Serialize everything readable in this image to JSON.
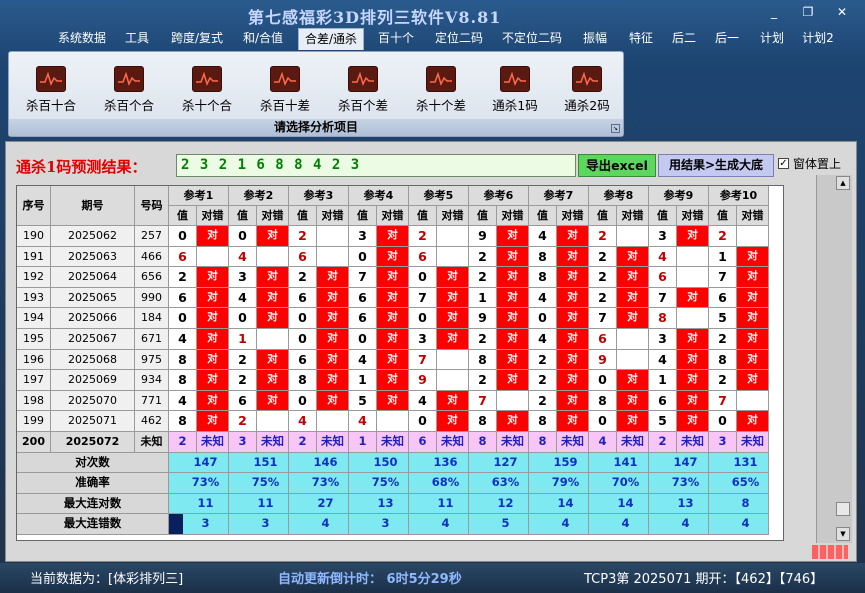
{
  "app": {
    "title": "第七感福彩3D排列三软件V8.81",
    "window_buttons": [
      "_",
      "❐",
      "✕"
    ]
  },
  "menu": [
    {
      "label": "系统数据"
    },
    {
      "label": "工具"
    },
    {
      "label": "跨度/复式"
    },
    {
      "label": "和/合值"
    },
    {
      "label": "合差/通杀",
      "active": true
    },
    {
      "label": "百十个"
    },
    {
      "label": "定位二码"
    },
    {
      "label": "不定位二码"
    },
    {
      "label": "振幅"
    },
    {
      "label": "特征"
    },
    {
      "label": "后二"
    },
    {
      "label": "后一"
    },
    {
      "label": "计划"
    },
    {
      "label": "计划2"
    }
  ],
  "ribbon": {
    "items": [
      {
        "label": "杀百十合",
        "icon": "chart-icon"
      },
      {
        "label": "杀百个合",
        "icon": "chart-icon"
      },
      {
        "label": "杀十个合",
        "icon": "chart-icon"
      },
      {
        "label": "杀百十差",
        "icon": "chart-icon"
      },
      {
        "label": "杀百个差",
        "icon": "chart-icon"
      },
      {
        "label": "杀十个差",
        "icon": "chart-icon"
      },
      {
        "label": "通杀1码",
        "icon": "chart-icon"
      },
      {
        "label": "通杀2码",
        "icon": "chart-icon"
      }
    ],
    "caption": "请选择分析项目"
  },
  "prediction": {
    "label": "通杀1码预测结果：",
    "value": "2 3 2 1 6 8 8 4 2 3",
    "export_button": "导出excel",
    "generate_button": "用结果>生成大底",
    "topmost_checked": true,
    "topmost_label": "窗体置上"
  },
  "table": {
    "col_headers": {
      "seq": "序号",
      "period": "期号",
      "number": "号码"
    },
    "groups": [
      "参考1",
      "参考2",
      "参考3",
      "参考4",
      "参考5",
      "参考6",
      "参考7",
      "参考8",
      "参考9",
      "参考10"
    ],
    "sub_headers": {
      "value": "值",
      "result": "对错"
    },
    "hit_text": "对",
    "rows": [
      {
        "seq": "190",
        "period": "2025062",
        "number": "257",
        "refs": [
          [
            "0",
            1,
            0
          ],
          [
            "0",
            1,
            0
          ],
          [
            "2",
            0,
            1
          ],
          [
            "3",
            1,
            0
          ],
          [
            "2",
            0,
            1
          ],
          [
            "9",
            1,
            0
          ],
          [
            "4",
            1,
            0
          ],
          [
            "2",
            0,
            1
          ],
          [
            "3",
            1,
            0
          ],
          [
            "2",
            0,
            1
          ]
        ]
      },
      {
        "seq": "191",
        "period": "2025063",
        "number": "466",
        "refs": [
          [
            "6",
            0,
            1
          ],
          [
            "4",
            0,
            1
          ],
          [
            "6",
            0,
            1
          ],
          [
            "0",
            1,
            0
          ],
          [
            "6",
            0,
            1
          ],
          [
            "2",
            1,
            0
          ],
          [
            "8",
            1,
            0
          ],
          [
            "2",
            1,
            0
          ],
          [
            "4",
            0,
            1
          ],
          [
            "1",
            1,
            0
          ]
        ]
      },
      {
        "seq": "192",
        "period": "2025064",
        "number": "656",
        "refs": [
          [
            "2",
            1,
            0
          ],
          [
            "3",
            1,
            0
          ],
          [
            "2",
            1,
            0
          ],
          [
            "7",
            1,
            0
          ],
          [
            "0",
            1,
            0
          ],
          [
            "2",
            1,
            0
          ],
          [
            "8",
            1,
            0
          ],
          [
            "2",
            1,
            0
          ],
          [
            "6",
            0,
            1
          ],
          [
            "7",
            1,
            0
          ]
        ]
      },
      {
        "seq": "193",
        "period": "2025065",
        "number": "990",
        "refs": [
          [
            "6",
            1,
            0
          ],
          [
            "4",
            1,
            0
          ],
          [
            "6",
            1,
            0
          ],
          [
            "6",
            1,
            0
          ],
          [
            "7",
            1,
            0
          ],
          [
            "1",
            1,
            0
          ],
          [
            "4",
            1,
            0
          ],
          [
            "2",
            1,
            0
          ],
          [
            "7",
            1,
            0
          ],
          [
            "6",
            1,
            0
          ]
        ]
      },
      {
        "seq": "194",
        "period": "2025066",
        "number": "184",
        "refs": [
          [
            "0",
            1,
            0
          ],
          [
            "0",
            1,
            0
          ],
          [
            "0",
            1,
            0
          ],
          [
            "6",
            1,
            0
          ],
          [
            "0",
            1,
            0
          ],
          [
            "9",
            1,
            0
          ],
          [
            "0",
            1,
            0
          ],
          [
            "7",
            1,
            0
          ],
          [
            "8",
            0,
            1
          ],
          [
            "5",
            1,
            0
          ]
        ]
      },
      {
        "seq": "195",
        "period": "2025067",
        "number": "671",
        "refs": [
          [
            "4",
            1,
            0
          ],
          [
            "1",
            0,
            1
          ],
          [
            "0",
            1,
            0
          ],
          [
            "0",
            1,
            0
          ],
          [
            "3",
            1,
            0
          ],
          [
            "2",
            1,
            0
          ],
          [
            "4",
            1,
            0
          ],
          [
            "6",
            0,
            1
          ],
          [
            "3",
            1,
            0
          ],
          [
            "2",
            1,
            0
          ]
        ]
      },
      {
        "seq": "196",
        "period": "2025068",
        "number": "975",
        "refs": [
          [
            "8",
            1,
            0
          ],
          [
            "2",
            1,
            0
          ],
          [
            "6",
            1,
            0
          ],
          [
            "4",
            1,
            0
          ],
          [
            "7",
            0,
            1
          ],
          [
            "8",
            1,
            0
          ],
          [
            "2",
            1,
            0
          ],
          [
            "9",
            0,
            1
          ],
          [
            "4",
            1,
            0
          ],
          [
            "8",
            1,
            0
          ]
        ]
      },
      {
        "seq": "197",
        "period": "2025069",
        "number": "934",
        "refs": [
          [
            "8",
            1,
            0
          ],
          [
            "2",
            1,
            0
          ],
          [
            "8",
            1,
            0
          ],
          [
            "1",
            1,
            0
          ],
          [
            "9",
            0,
            1
          ],
          [
            "2",
            1,
            0
          ],
          [
            "2",
            1,
            0
          ],
          [
            "0",
            1,
            0
          ],
          [
            "1",
            1,
            0
          ],
          [
            "2",
            1,
            0
          ]
        ]
      },
      {
        "seq": "198",
        "period": "2025070",
        "number": "771",
        "refs": [
          [
            "4",
            1,
            0
          ],
          [
            "6",
            1,
            0
          ],
          [
            "0",
            1,
            0
          ],
          [
            "5",
            1,
            0
          ],
          [
            "4",
            1,
            0
          ],
          [
            "7",
            0,
            1
          ],
          [
            "2",
            1,
            0
          ],
          [
            "8",
            1,
            0
          ],
          [
            "6",
            1,
            0
          ],
          [
            "7",
            0,
            1
          ]
        ]
      },
      {
        "seq": "199",
        "period": "2025071",
        "number": "462",
        "refs": [
          [
            "8",
            1,
            0
          ],
          [
            "2",
            0,
            1
          ],
          [
            "4",
            0,
            1
          ],
          [
            "4",
            0,
            1
          ],
          [
            "0",
            1,
            0
          ],
          [
            "8",
            1,
            0
          ],
          [
            "8",
            1,
            0
          ],
          [
            "0",
            1,
            0
          ],
          [
            "5",
            1,
            0
          ],
          [
            "0",
            1,
            0
          ]
        ]
      }
    ],
    "prediction_row": {
      "seq": "200",
      "period": "2025072",
      "number": "未知",
      "values": [
        "2",
        "3",
        "2",
        "1",
        "6",
        "8",
        "8",
        "4",
        "2",
        "3"
      ],
      "result_text": "未知"
    },
    "stats": [
      {
        "label": "对次数",
        "values": [
          "147",
          "151",
          "146",
          "150",
          "136",
          "127",
          "159",
          "141",
          "147",
          "131"
        ]
      },
      {
        "label": "准确率",
        "values": [
          "73%",
          "75%",
          "73%",
          "75%",
          "68%",
          "63%",
          "79%",
          "70%",
          "73%",
          "65%"
        ]
      },
      {
        "label": "最大连对数",
        "values": [
          "11",
          "11",
          "27",
          "13",
          "11",
          "12",
          "14",
          "14",
          "13",
          "8"
        ]
      },
      {
        "label": "最大连错数",
        "values": [
          "3",
          "3",
          "4",
          "3",
          "4",
          "5",
          "4",
          "4",
          "4",
          "4"
        ]
      }
    ]
  },
  "status": {
    "source": "当前数据为：[体彩排列三]",
    "timer": "自动更新倒计时：  6时5分29秒",
    "open": "TCP3第 2025071 期开：【462】【746】"
  },
  "colors": {
    "hit": "#ff0000",
    "prediction_row": "#f7c6f7",
    "stats_row": "#7ee9f0",
    "miss_digit": "#c00000"
  }
}
